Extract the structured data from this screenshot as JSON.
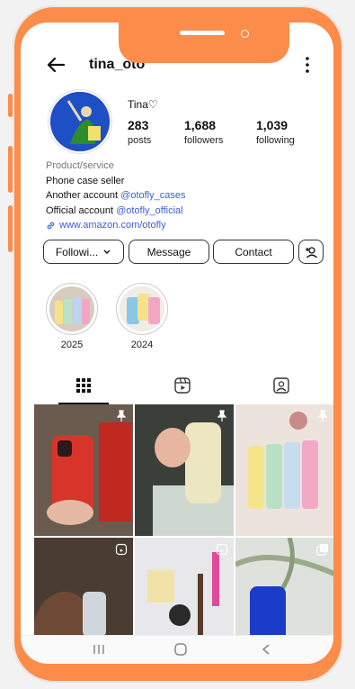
{
  "profile": {
    "username": "tina_oto",
    "display_name": "Tina♡",
    "stats": [
      {
        "value": "283",
        "label": "posts"
      },
      {
        "value": "1,688",
        "label": "followers"
      },
      {
        "value": "1,039",
        "label": "following"
      }
    ]
  },
  "bio": {
    "category": "Product/service",
    "line1": "Phone case seller",
    "line2_prefix": "Another account ",
    "line2_mention": "@otofly_cases",
    "line3_prefix": "Official account ",
    "line3_mention": "@otofly_official",
    "link": "www.amazon.com/otofly"
  },
  "actions": {
    "following": "Followi...",
    "message": "Message",
    "contact": "Contact"
  },
  "highlights": [
    {
      "label": "2025"
    },
    {
      "label": "2024"
    }
  ],
  "tabs": [
    "grid-icon",
    "reels-icon",
    "tagged-icon"
  ],
  "colors": {
    "accent": "#fb8c4a",
    "link": "#3b5fd8"
  }
}
